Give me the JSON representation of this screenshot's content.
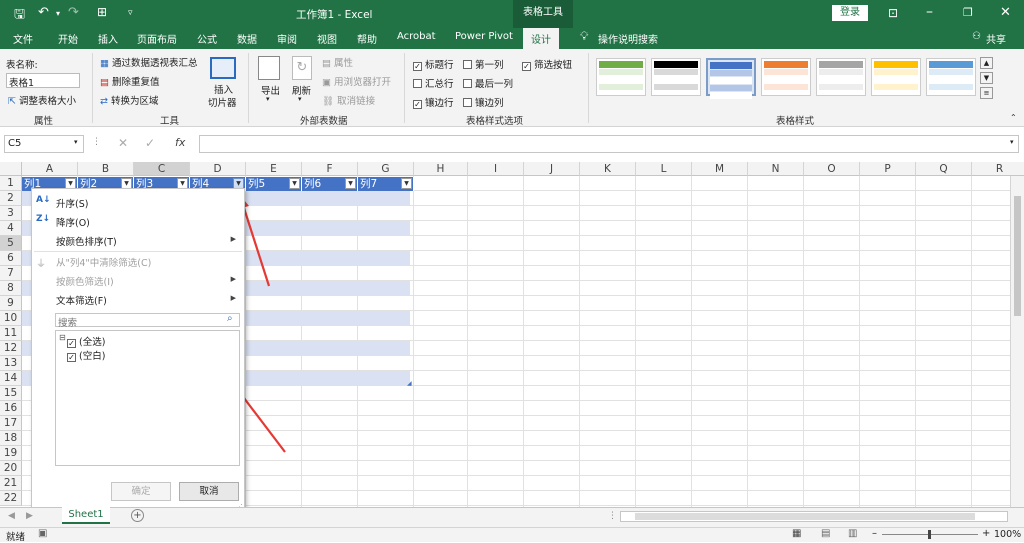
{
  "titlebar": {
    "title": "工作簿1  -  Excel",
    "context": "表格工具",
    "login": "登录"
  },
  "tabs": [
    "文件",
    "开始",
    "插入",
    "页面布局",
    "公式",
    "数据",
    "审阅",
    "视图",
    "帮助",
    "Acrobat",
    "Power Pivot",
    "设计"
  ],
  "tell_me": "操作说明搜索",
  "share": "共享",
  "ribbon": {
    "props": {
      "name_label": "表名称:",
      "name_value": "表格1",
      "resize": "调整表格大小",
      "group": "属性"
    },
    "tools": {
      "pivot": "通过数据透视表汇总",
      "dedupe": "删除重复值",
      "convert": "转换为区域",
      "slicer1": "插入",
      "slicer2": "切片器",
      "group": "工具"
    },
    "external": {
      "export": "导出",
      "refresh": "刷新",
      "properties": "属性",
      "browser": "用浏览器打开",
      "unlink": "取消链接",
      "group": "外部表数据"
    },
    "options": {
      "header_row": "标题行",
      "first_col": "第一列",
      "filter_btn": "筛选按钮",
      "total_row": "汇总行",
      "last_col": "最后一列",
      "banded_rows": "镶边行",
      "banded_cols": "镶边列",
      "group": "表格样式选项"
    },
    "styles_group": "表格样式",
    "style_colors": [
      "#70ad47",
      "#000000",
      "#4472c4",
      "#ed7d31",
      "#a5a5a5",
      "#ffc000",
      "#5b9bd5"
    ]
  },
  "formula": {
    "namebox": "C5",
    "fx": "fx"
  },
  "columns": [
    "A",
    "B",
    "C",
    "D",
    "E",
    "F",
    "G",
    "H",
    "I",
    "J",
    "K",
    "L",
    "M",
    "N",
    "O",
    "P",
    "Q",
    "R"
  ],
  "rows": [
    "1",
    "2",
    "3",
    "4",
    "5",
    "6",
    "7",
    "8",
    "9",
    "10",
    "11",
    "12",
    "13",
    "14",
    "15",
    "16",
    "17",
    "18",
    "19",
    "20",
    "21",
    "22"
  ],
  "headers": [
    "列1",
    "列2",
    "列3",
    "列4",
    "列5",
    "列6",
    "列7"
  ],
  "menu": {
    "sort_asc": "升序(S)",
    "sort_desc": "降序(O)",
    "sort_color": "按颜色排序(T)",
    "clear": "从\"列4\"中清除筛选(C)",
    "filter_color": "按颜色筛选(I)",
    "text_filter": "文本筛选(F)",
    "search_placeholder": "搜索",
    "select_all": "(全选)",
    "blank": "(空白)",
    "ok": "确定",
    "cancel": "取消"
  },
  "sheet": {
    "tab": "Sheet1"
  },
  "status": {
    "ready": "就绪",
    "zoom": "100%"
  }
}
